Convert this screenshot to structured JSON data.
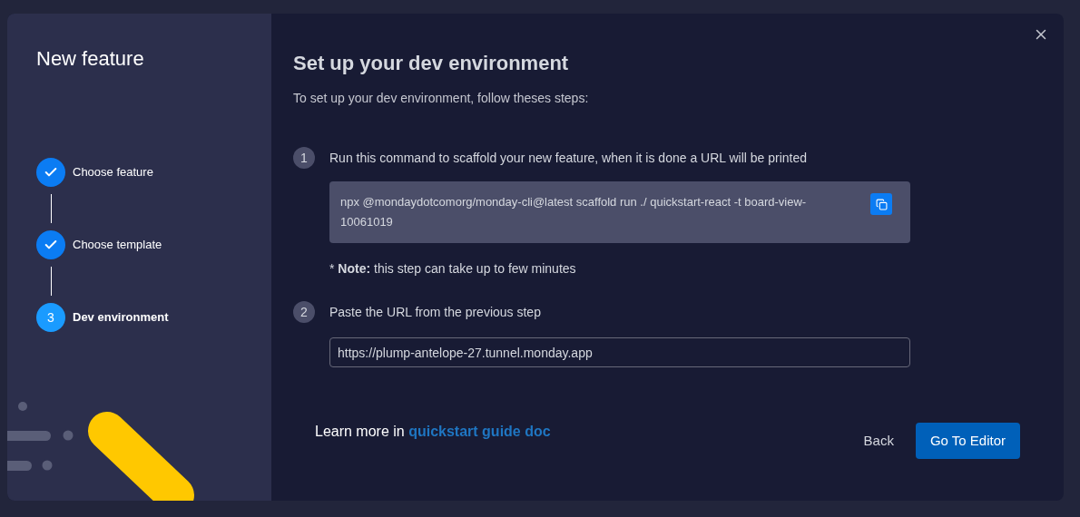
{
  "sidebar": {
    "title": "New feature",
    "steps": [
      {
        "label": "Choose feature",
        "completed": true,
        "selected": false
      },
      {
        "label": "Choose template",
        "completed": true,
        "selected": false
      },
      {
        "number": "3",
        "label": "Dev environment",
        "completed": false,
        "selected": true
      }
    ]
  },
  "main": {
    "title": "Set up your dev environment",
    "subtitle": "To set up your dev environment, follow theses steps:",
    "instructions": [
      {
        "number": "1",
        "kind": "command",
        "text": "Run this command to scaffold your new feature, when it is done a URL will be printed",
        "command": "npx @mondaydotcomorg/monday-cli@latest scaffold run ./ quickstart-react -t board-view-10061019",
        "note": "* **Note:** this step can take up to few minutes"
      },
      {
        "number": "2",
        "kind": "input",
        "text": "Paste the URL from the previous step",
        "value": "https://plump-antelope-27.tunnel.monday.app"
      }
    ],
    "learn_more": {
      "text": "Learn more in",
      "link": "quickstart guide doc"
    },
    "buttons": {
      "back": "Back",
      "primary": "Go To Editor"
    }
  }
}
